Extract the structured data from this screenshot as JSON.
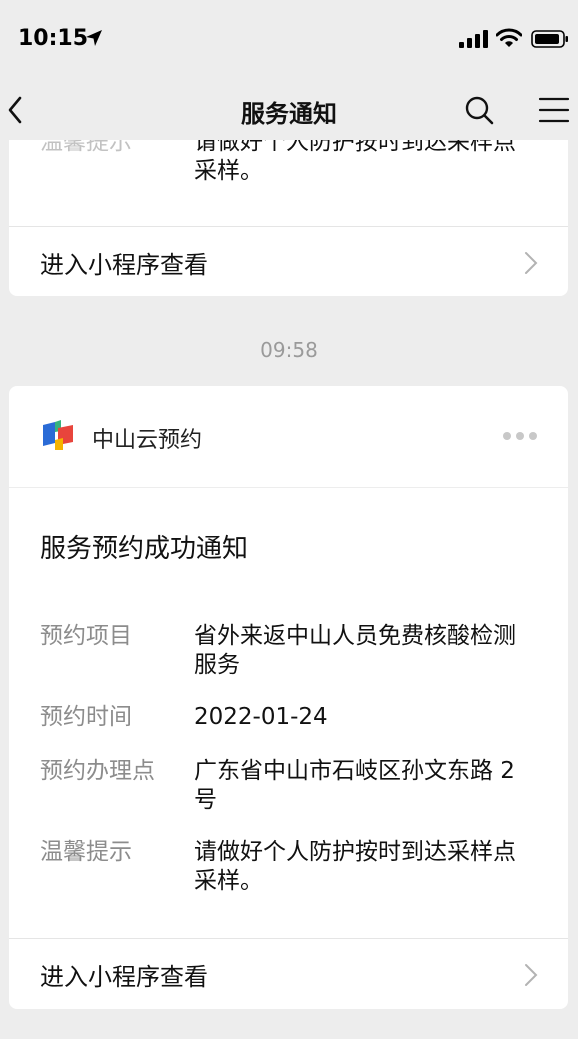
{
  "status_bar": {
    "time": "10:15"
  },
  "nav": {
    "title": "服务通知"
  },
  "previous_card": {
    "partial_label": "温馨提示",
    "partial_value_line1": "请做好个人防护按时到达采样点",
    "partial_value_line2": "采样。",
    "link": "进入小程序查看"
  },
  "timestamp": "09:58",
  "card": {
    "brand_name": "中山云预约",
    "notice_title": "服务预约成功通知",
    "fields": [
      {
        "label": "预约项目",
        "value_line1": "省外来返中山人员免费核酸检测",
        "value_line2": "服务"
      },
      {
        "label": "预约时间",
        "value_line1": "2022-01-24",
        "value_line2": ""
      },
      {
        "label": "预约办理点",
        "value_line1": "广东省中山市石岐区孙文东路 2",
        "value_line2": "号"
      },
      {
        "label": "温馨提示",
        "value_line1": "请做好个人防护按时到达采样点",
        "value_line2": "采样。"
      }
    ],
    "link": "进入小程序查看"
  },
  "colors": {
    "background": "#ededed",
    "card": "#ffffff",
    "label_gray": "#8c8c8c",
    "logo_red": "#e8453c",
    "logo_blue": "#2a6bd6",
    "logo_green": "#36b37e",
    "logo_yellow": "#f5b400"
  },
  "icons": [
    "location-arrow-icon",
    "signal-icon",
    "wifi-icon",
    "battery-icon",
    "back-icon",
    "search-icon",
    "menu-icon",
    "chevron-right-icon",
    "more-dots-icon",
    "brand-logo"
  ]
}
